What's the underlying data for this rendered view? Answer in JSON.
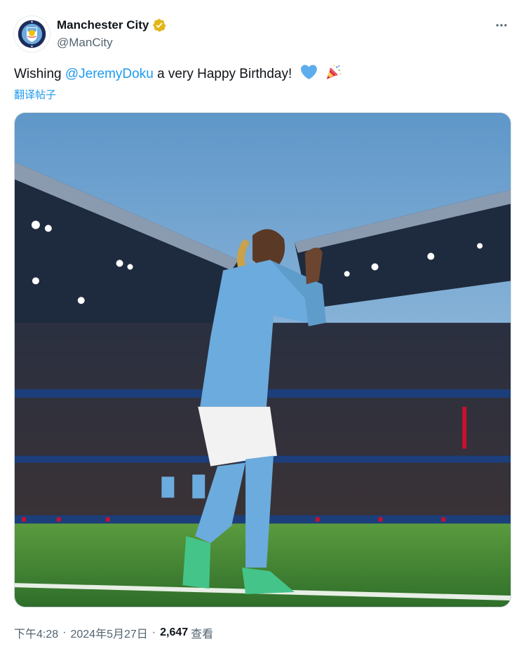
{
  "author": {
    "display_name": "Manchester City",
    "handle": "@ManCity",
    "avatar_icon": "man-city-crest-icon",
    "verified_icon": "gold-verified-badge-icon",
    "verified_color": "#e2b719"
  },
  "tweet": {
    "text_prefix": "Wishing ",
    "mention": "@JeremyDoku",
    "text_suffix": " a very Happy Birthday!",
    "emojis": [
      "blue-heart-emoji",
      "party-popper-emoji"
    ],
    "translate_label": "翻译帖子"
  },
  "media": {
    "alt": "Jeremy Doku applauding on the pitch in a stadium",
    "colors": {
      "kit": "#6cabdd",
      "pitch": "#3f8a3a",
      "sky": "#7fb0d8"
    }
  },
  "meta": {
    "time": "下午4:28",
    "date": "2024年5月27日",
    "views_count": "2,647",
    "views_label": "查看"
  },
  "colors": {
    "link": "#1d9bf0",
    "secondary_text": "#536471",
    "primary_text": "#0f1419"
  }
}
